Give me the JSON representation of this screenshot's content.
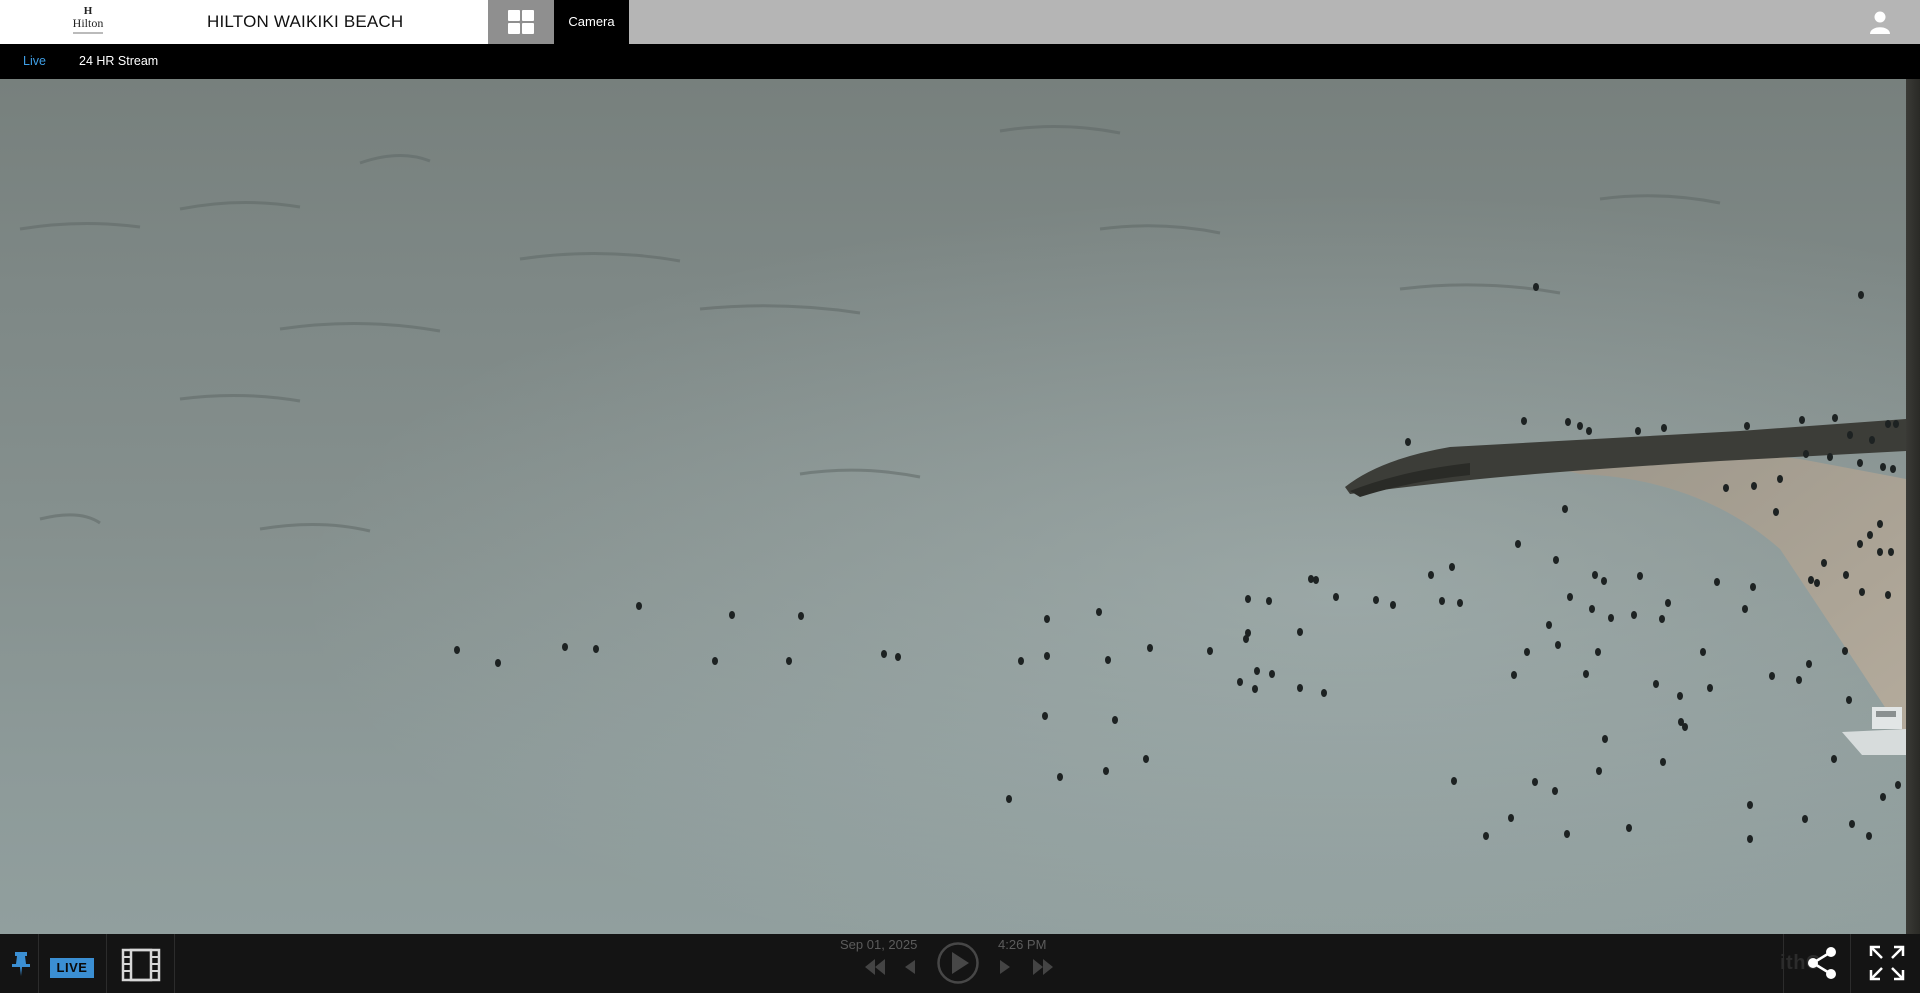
{
  "header": {
    "logo": {
      "mark": "H",
      "word": "Hilton",
      "icon": "hilton-logo"
    },
    "site_title": "HILTON WAIKIKI BEACH",
    "grid_icon": "grid-icon",
    "camera_tab_label": "Camera",
    "user_icon": "user-icon"
  },
  "subnav": {
    "live_label": "Live",
    "stream_label": "24 HR Stream"
  },
  "video": {
    "description_icon": "live-camera-feed"
  },
  "player": {
    "pin_icon": "pin-icon",
    "live_badge": "LIVE",
    "film_icon": "film-icon",
    "date": "Sep 01, 2025",
    "time": "4:26 PM",
    "controls": [
      "skip-back-icon",
      "step-back-icon",
      "play-icon",
      "step-forward-icon",
      "skip-forward-icon"
    ],
    "watermark": "ithC",
    "share_icon": "share-icon",
    "fullscreen_icon": "fullscreen-icon"
  },
  "colors": {
    "accent": "#3b8fd3",
    "live_link": "#3f9fe6",
    "header_gray": "#b5b5b5",
    "grid_button": "#8f8f8f"
  }
}
